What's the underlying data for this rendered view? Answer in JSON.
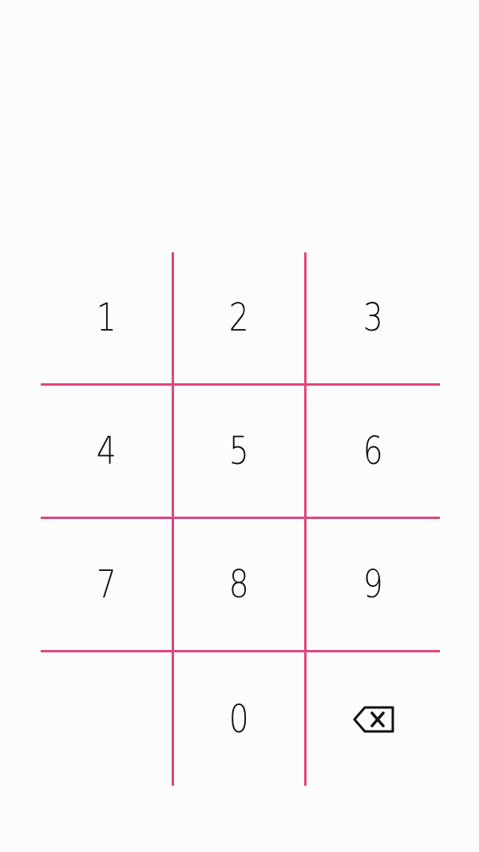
{
  "colors": {
    "background": "#fcfcfd",
    "grid_line": "#e0457e",
    "digit_text": "#111111"
  },
  "keypad": {
    "keys": [
      {
        "label": "1"
      },
      {
        "label": "2"
      },
      {
        "label": "3"
      },
      {
        "label": "4"
      },
      {
        "label": "5"
      },
      {
        "label": "6"
      },
      {
        "label": "7"
      },
      {
        "label": "8"
      },
      {
        "label": "9"
      },
      {
        "label": ""
      },
      {
        "label": "0"
      },
      {
        "icon": "backspace-icon"
      }
    ]
  }
}
